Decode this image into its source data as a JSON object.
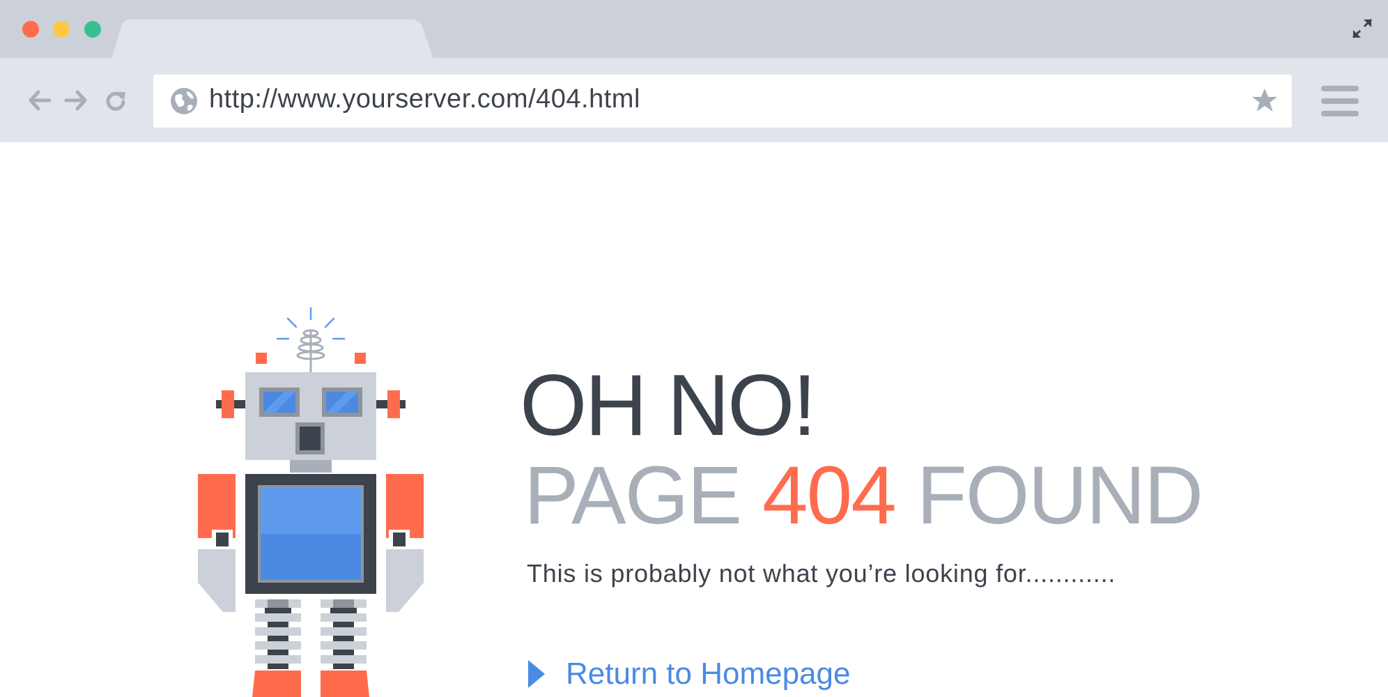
{
  "browser": {
    "url": "http://www.yourserver.com/404.html",
    "window_controls": [
      {
        "name": "close-dot",
        "color": "#ff6c4d"
      },
      {
        "name": "minimize-dot",
        "color": "#ffc843"
      },
      {
        "name": "maximize-dot",
        "color": "#36bf90"
      }
    ],
    "icons": {
      "back": "arrow-left-icon",
      "forward": "arrow-right-icon",
      "reload": "reload-icon",
      "site": "globe-icon",
      "bookmark": "star-icon",
      "menu": "hamburger-menu-icon",
      "fullscreen": "expand-icon"
    }
  },
  "error_page": {
    "headline": "OH NO!",
    "subheadline_prefix": "PAGE ",
    "subheadline_code": "404",
    "subheadline_suffix": " FOUND",
    "description": "This is probably not what you’re looking for............",
    "return_link": "Return to Homepage",
    "illustration": "robot-illustration"
  },
  "colors": {
    "titlebar": "#ccd0d9",
    "toolbar": "#e1e4ea",
    "headline": "#3d434c",
    "subheadline": "#a8afb8",
    "accent": "#ff6c4d",
    "link": "#4a8ae3"
  }
}
